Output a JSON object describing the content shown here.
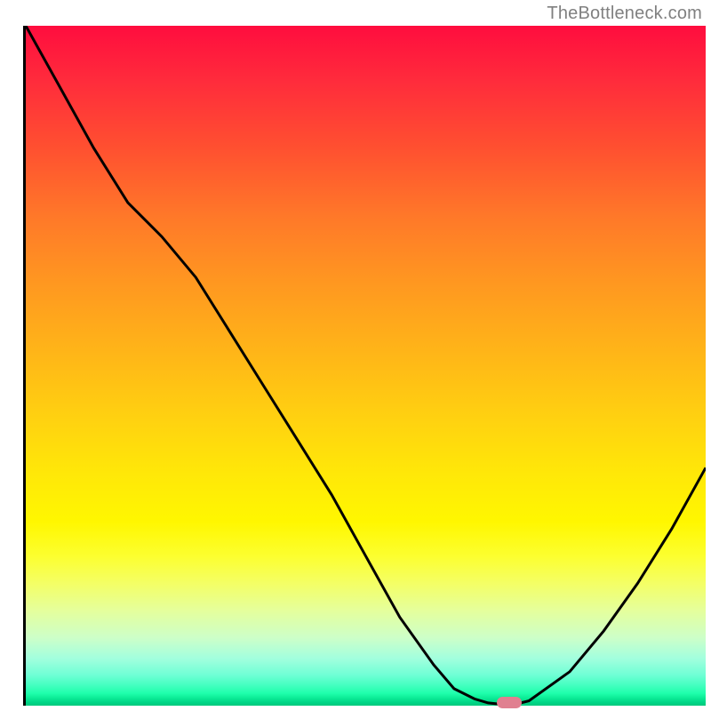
{
  "attribution": "TheBottleneck.com",
  "colors": {
    "gradient_top": "#ff0d3e",
    "gradient_mid": "#ffd210",
    "gradient_bottom": "#00c87d",
    "curve": "#000000",
    "marker": "#e08090",
    "axis": "#000000"
  },
  "chart_data": {
    "type": "line",
    "title": "",
    "xlabel": "",
    "ylabel": "",
    "xlim": [
      0,
      100
    ],
    "ylim": [
      0,
      100
    ],
    "x": [
      0,
      5,
      10,
      15,
      20,
      25,
      30,
      35,
      40,
      45,
      50,
      55,
      60,
      63,
      66,
      68,
      70,
      72,
      74,
      80,
      85,
      90,
      95,
      100
    ],
    "values": [
      100,
      91,
      82,
      74,
      69,
      63,
      55,
      47,
      39,
      31,
      22,
      13,
      6,
      2.5,
      1,
      0.4,
      0.2,
      0.2,
      0.7,
      5,
      11,
      18,
      26,
      35
    ],
    "series": [
      {
        "name": "bottleneck-curve",
        "x": [
          0,
          5,
          10,
          15,
          20,
          25,
          30,
          35,
          40,
          45,
          50,
          55,
          60,
          63,
          66,
          68,
          70,
          72,
          74,
          80,
          85,
          90,
          95,
          100
        ],
        "values": [
          100,
          91,
          82,
          74,
          69,
          63,
          55,
          47,
          39,
          31,
          22,
          13,
          6,
          2.5,
          1,
          0.4,
          0.2,
          0.2,
          0.7,
          5,
          11,
          18,
          26,
          35
        ]
      }
    ],
    "marker": {
      "x": 71,
      "y": 0.2
    }
  }
}
